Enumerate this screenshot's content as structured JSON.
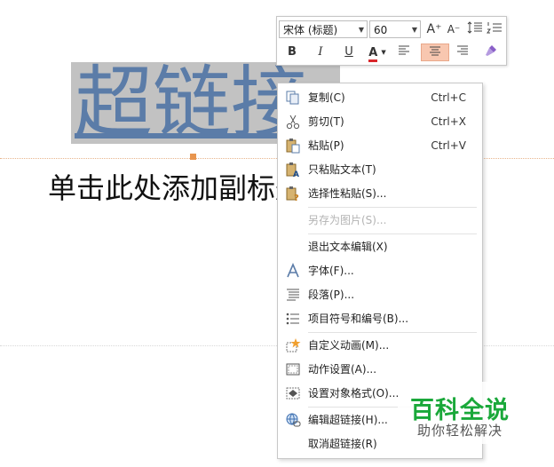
{
  "slide": {
    "title": "超链接",
    "subtitle": "单击此处添加副标题"
  },
  "toolbar": {
    "font_name": "宋体 (标题)",
    "font_size": "60",
    "grow_font": "A⁺",
    "shrink_font": "A⁻",
    "bold": "B",
    "italic": "I",
    "underline": "U",
    "font_color_letter": "A",
    "font_color_value": "#d9262b",
    "accent_active": "#f8c7b0"
  },
  "menu": {
    "items": [
      {
        "label": "复制(C)",
        "shortcut": "Ctrl+C",
        "icon": "copy-icon"
      },
      {
        "label": "剪切(T)",
        "shortcut": "Ctrl+X",
        "icon": "scissors-icon"
      },
      {
        "label": "粘贴(P)",
        "shortcut": "Ctrl+V",
        "icon": "paste-icon"
      },
      {
        "label": "只粘贴文本(T)",
        "shortcut": "",
        "icon": "paste-text-icon"
      },
      {
        "label": "选择性粘贴(S)...",
        "shortcut": "",
        "icon": "paste-special-icon"
      },
      {
        "label": "另存为图片(S)...",
        "shortcut": "",
        "icon": "",
        "disabled": true
      },
      {
        "label": "退出文本编辑(X)",
        "shortcut": "",
        "icon": ""
      },
      {
        "label": "字体(F)...",
        "shortcut": "",
        "icon": "font-icon"
      },
      {
        "label": "段落(P)...",
        "shortcut": "",
        "icon": "paragraph-icon"
      },
      {
        "label": "项目符号和编号(B)...",
        "shortcut": "",
        "icon": "bullets-icon"
      },
      {
        "label": "自定义动画(M)...",
        "shortcut": "",
        "icon": "animation-star-icon"
      },
      {
        "label": "动作设置(A)...",
        "shortcut": "",
        "icon": "action-icon"
      },
      {
        "label": "设置对象格式(O)...",
        "shortcut": "",
        "icon": "format-object-icon"
      },
      {
        "label": "编辑超链接(H)...",
        "shortcut": "",
        "icon": "hyperlink-globe-icon"
      },
      {
        "label": "取消超链接(R)",
        "shortcut": "",
        "icon": ""
      }
    ]
  },
  "watermark": {
    "title": "百科全说",
    "subtitle": "助你轻松解决"
  }
}
